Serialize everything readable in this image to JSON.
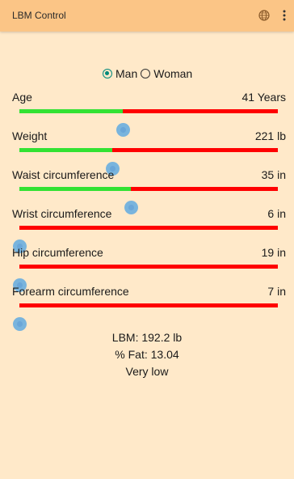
{
  "app": {
    "title": "LBM Control"
  },
  "toolbar": {
    "icons": [
      "globe-icon",
      "more-vert-icon"
    ]
  },
  "gender": {
    "options": [
      {
        "label": "Man",
        "checked": true
      },
      {
        "label": "Woman",
        "checked": false
      }
    ]
  },
  "sliders": [
    {
      "label": "Age",
      "value": "41 Years",
      "level": 0.4
    },
    {
      "label": "Weight",
      "value": "221 lb",
      "level": 0.36
    },
    {
      "label": "Waist circumference",
      "value": "35 in",
      "level": 0.43
    },
    {
      "label": "Wrist circumference",
      "value": "6 in",
      "level": 0
    },
    {
      "label": "Hip circumference",
      "value": "19 in",
      "level": 0
    },
    {
      "label": "Forearm circumference",
      "value": "7 in",
      "level": 0
    }
  ],
  "colors": {
    "background": "#ffe9c9",
    "appbar": "#fbc586",
    "track_filled": "#33e233",
    "track_empty": "#ff0000",
    "thumb": "#61aae1",
    "radio_checked": "#00897b"
  },
  "results": {
    "lbm": "LBM: 192.2 lb",
    "fat": "% Fat: 13.04",
    "rating": "Very low"
  }
}
